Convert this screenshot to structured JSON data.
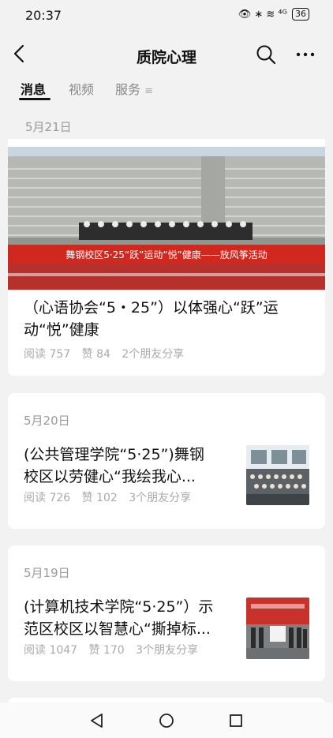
{
  "status": {
    "time": "20:37",
    "icons": "👁 ∗ ≋ ⁴ᴳ",
    "battery": "36"
  },
  "header": {
    "title": "质院心理"
  },
  "tabs": [
    {
      "label": "消息"
    },
    {
      "label": "视频"
    },
    {
      "label": "服务"
    }
  ],
  "tab_menu_icon": "≡",
  "feed": {
    "top_date": "5月21日",
    "banner_text": "舞钢校区5·25“跃”运动“悦”健康——放风筝活动",
    "articles": [
      {
        "title": "（心语协会“5・25”）以体强心“跃”运动“悦”健康",
        "reads": "阅读 757",
        "likes": "赞 84",
        "shares": "2个朋友分享"
      },
      {
        "date": "5月20日",
        "title_line1": "(公共管理学院“5·25”)舞钢",
        "title_line2": "校区以劳健心“我绘我心...",
        "reads": "阅读 726",
        "likes": "赞 102",
        "shares": "3个朋友分享"
      },
      {
        "date": "5月19日",
        "title_line1": "(计算机技术学院“5·25”）示",
        "title_line2": "范区校区以智慧心“撕掉标...",
        "reads": "阅读 1047",
        "likes": "赞 170",
        "shares": "3个朋友分享"
      }
    ]
  }
}
